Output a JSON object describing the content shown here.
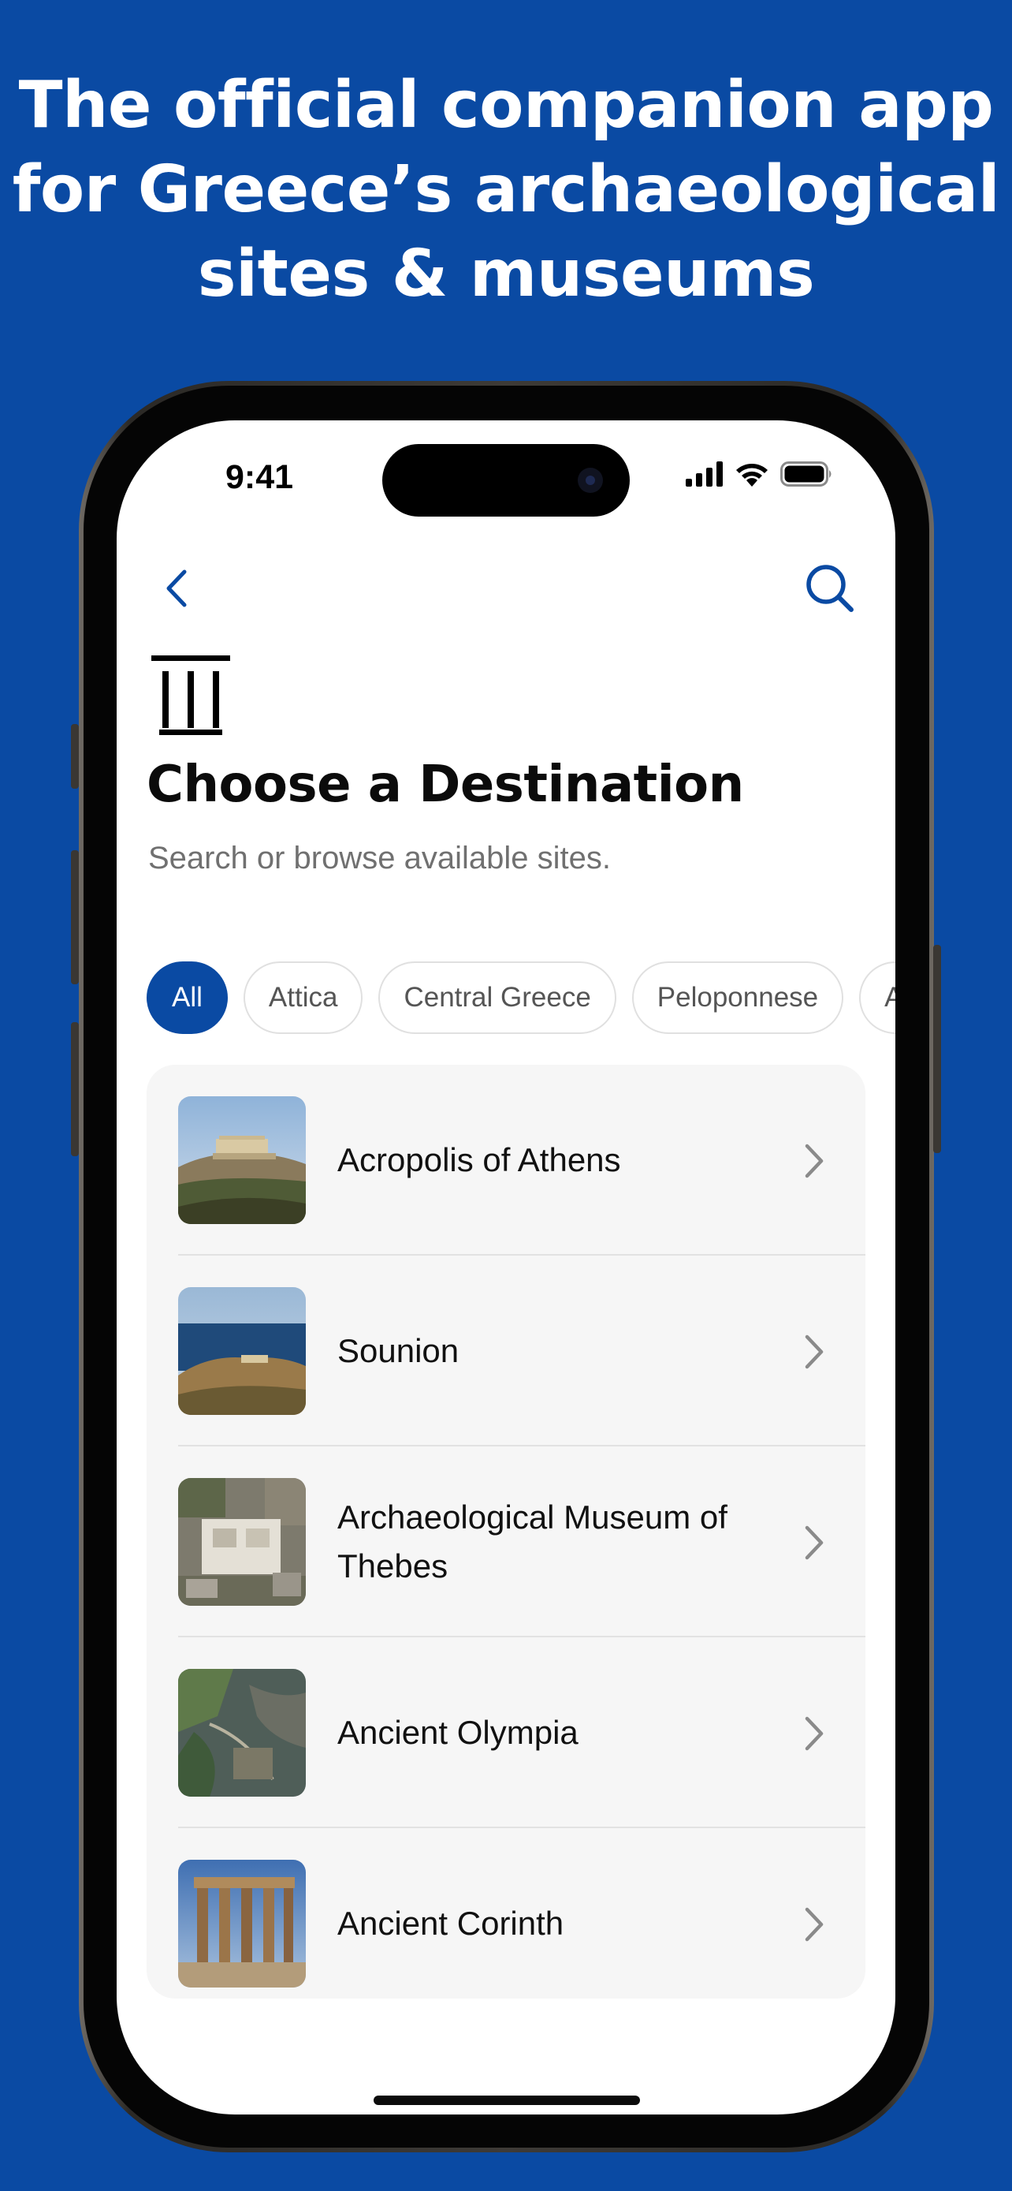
{
  "headline": {
    "line1": "The official companion app",
    "line2": "for Greece’s archaeological",
    "line3": "sites & museums"
  },
  "status_bar": {
    "time": "9:41",
    "icons": [
      "cellular-signal-icon",
      "wifi-icon",
      "battery-icon"
    ]
  },
  "nav": {
    "back_icon": "chevron-left-icon",
    "search_icon": "search-icon"
  },
  "header": {
    "icon": "greek-columns-icon",
    "title": "Choose a Destination",
    "subtitle": "Search or browse available sites."
  },
  "filters": [
    {
      "label": "All",
      "selected": true
    },
    {
      "label": "Attica",
      "selected": false
    },
    {
      "label": "Central Greece",
      "selected": false
    },
    {
      "label": "Peloponnese",
      "selected": false
    },
    {
      "label": "Ac",
      "selected": false
    }
  ],
  "destinations": [
    {
      "name": "Acropolis of Athens",
      "thumb": "acropolis-photo"
    },
    {
      "name": "Sounion",
      "thumb": "sounion-photo"
    },
    {
      "name": "Archaeological Museum of Thebes",
      "thumb": "thebes-museum-photo"
    },
    {
      "name": "Ancient Olympia",
      "thumb": "olympia-aerial-photo"
    },
    {
      "name": "Ancient Corinth",
      "thumb": "corinth-temple-photo"
    }
  ],
  "colors": {
    "brand_blue": "#0a4aa3",
    "list_background": "#f6f6f6",
    "chip_border": "#e0e0e0",
    "subtitle_gray": "#707070"
  }
}
